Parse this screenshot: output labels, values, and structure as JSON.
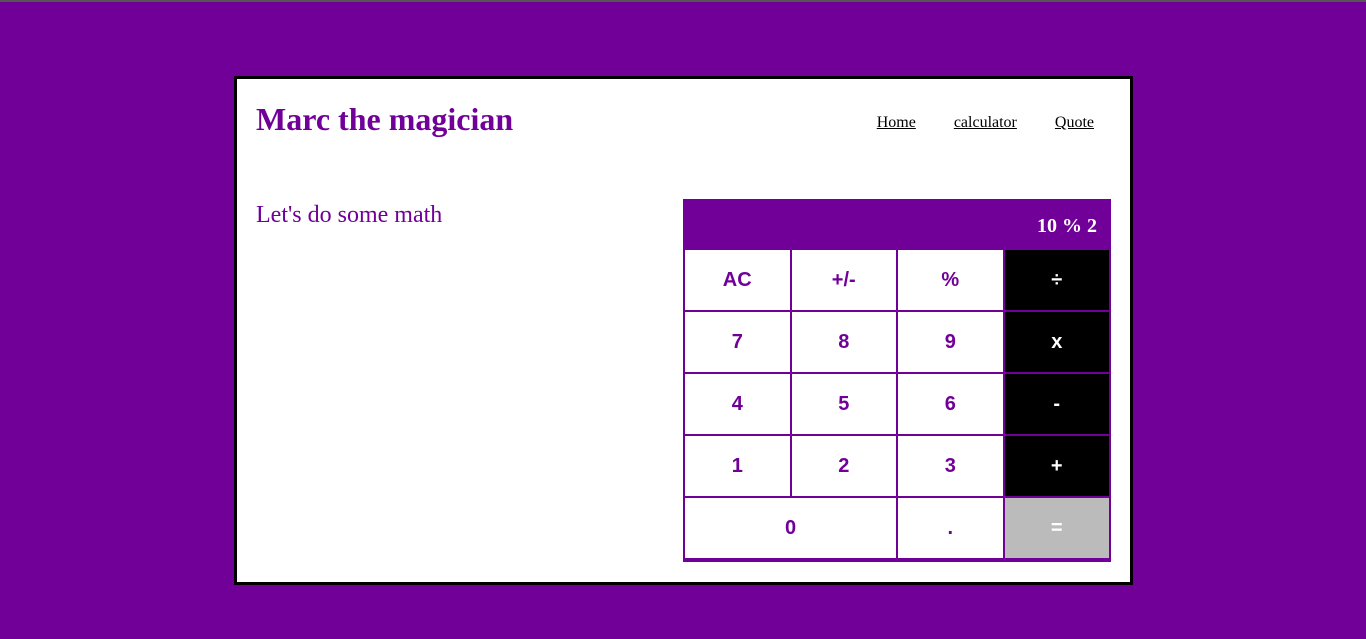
{
  "header": {
    "title": "Marc the magician",
    "nav": [
      {
        "label": "Home"
      },
      {
        "label": "calculator"
      },
      {
        "label": "Quote"
      }
    ]
  },
  "main": {
    "intro": "Let's do some math"
  },
  "calculator": {
    "display": "10 % 2",
    "keys": {
      "ac": "AC",
      "sign": "+/-",
      "percent": "%",
      "divide": "÷",
      "seven": "7",
      "eight": "8",
      "nine": "9",
      "multiply": "x",
      "four": "4",
      "five": "5",
      "six": "6",
      "subtract": "-",
      "one": "1",
      "two": "2",
      "three": "3",
      "add": "+",
      "zero": "0",
      "decimal": ".",
      "equals": "="
    }
  },
  "colors": {
    "background": "#710099",
    "accent": "#710099",
    "operator": "#000000",
    "equals": "#bbbbbb"
  }
}
